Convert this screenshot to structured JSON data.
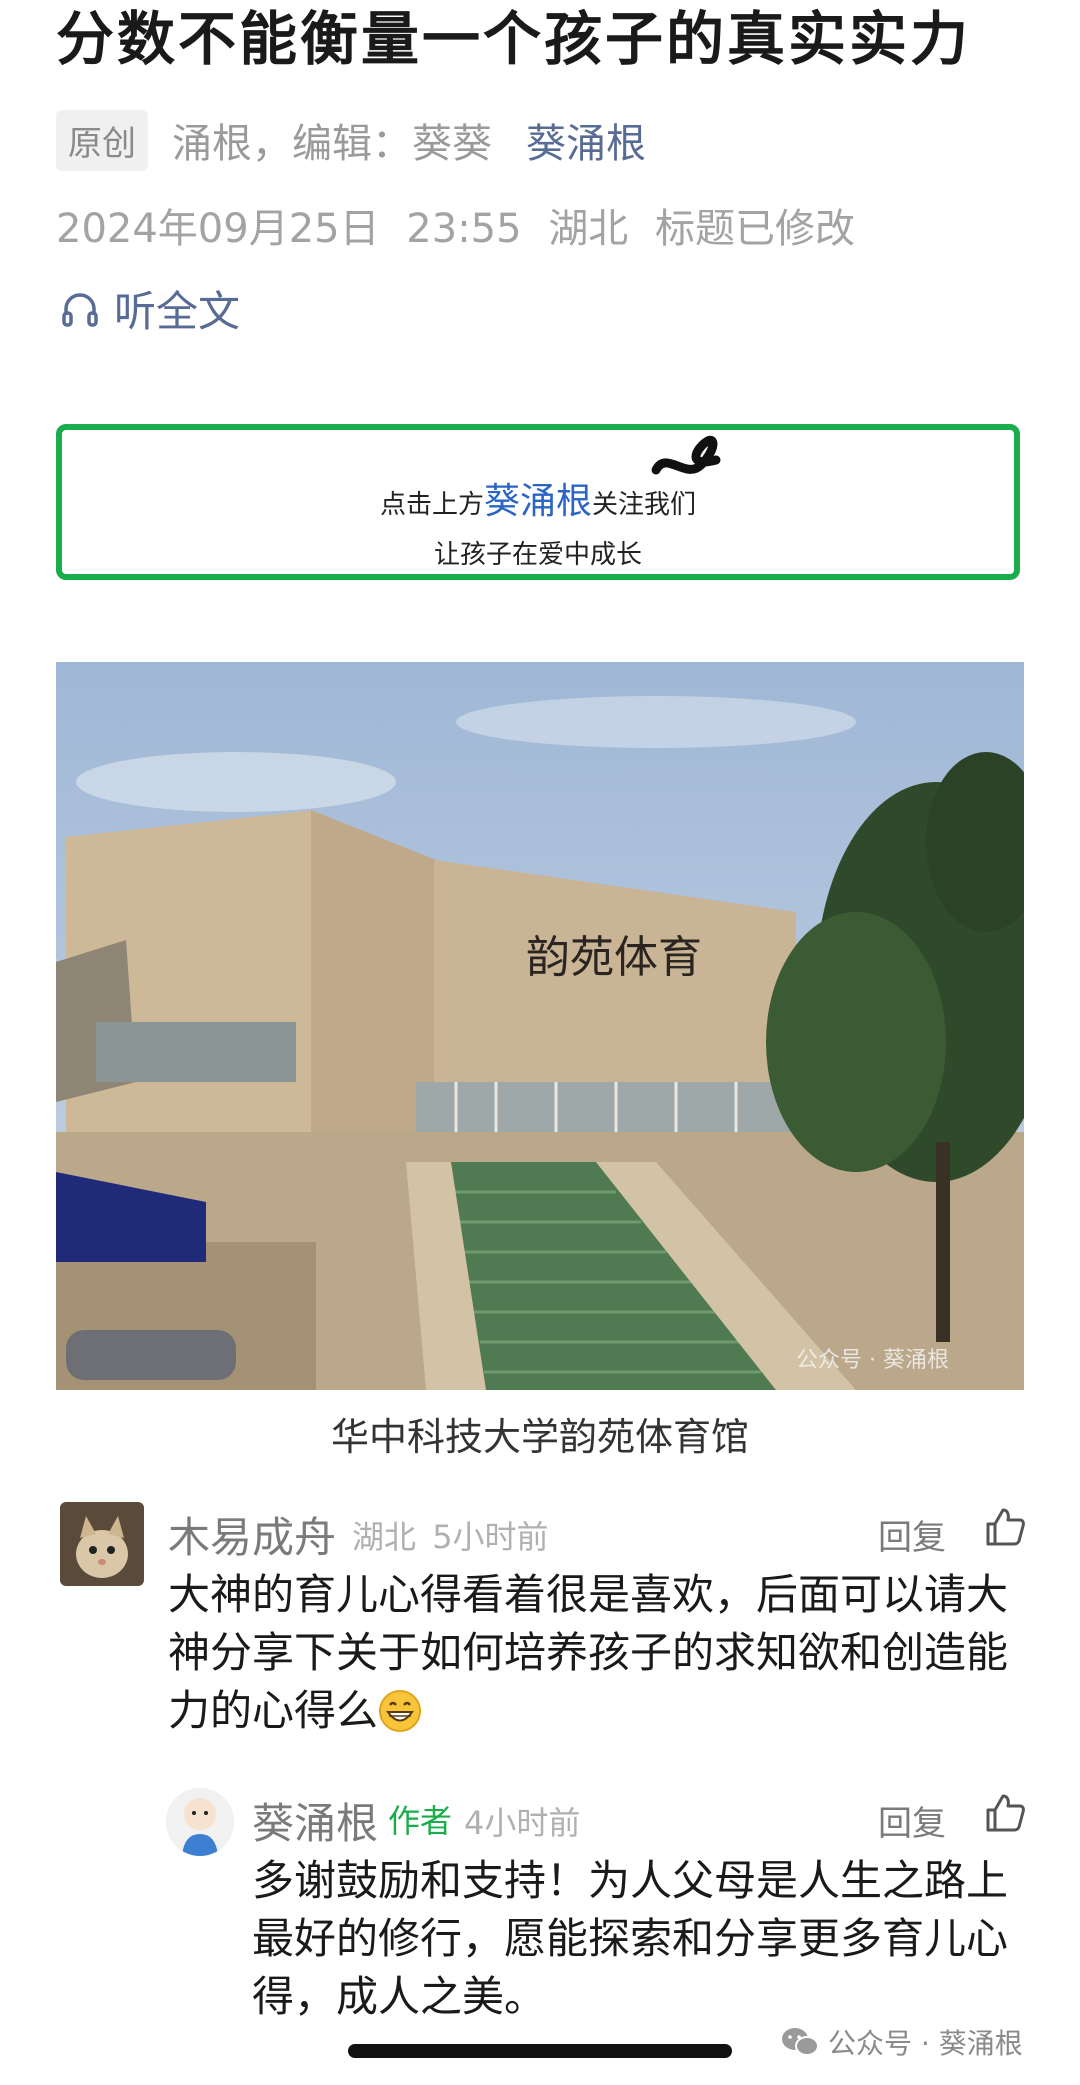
{
  "article": {
    "title": "分数不能衡量一个孩子的真实实力",
    "badge": "原创",
    "authors": "涌根，编辑：葵葵",
    "account": "葵涌根",
    "datetime": "2024年09月25日 23:55",
    "location": "湖北",
    "edited": "标题已修改",
    "listen": "听全文"
  },
  "follow_banner": {
    "prefix": "点击上方",
    "account": "葵涌根",
    "suffix": "关注我们",
    "line2": "让孩子在爱中成长",
    "border_color": "#1aad4b"
  },
  "photo": {
    "sign": "韵苑体育",
    "watermark": "公众号 · 葵涌根",
    "caption": "华中科技大学韵苑体育馆"
  },
  "comments": [
    {
      "name": "木易成舟",
      "location": "湖北",
      "time": "5小时前",
      "reply_label": "回复",
      "text": "大神的育儿心得看着很是喜欢，后面可以请大神分享下关于如何培养孩子的求知欲和创造能力的心得么",
      "emoji": "grin-emoji"
    },
    {
      "name": "葵涌根",
      "tag": "作者",
      "time": "4小时前",
      "reply_label": "回复",
      "text": "多谢鼓励和支持！为人父母是人生之路上最好的修行，愿能探索和分享更多育儿心得，成人之美。"
    }
  ],
  "watermark": "公众号 · 葵涌根",
  "colors": {
    "link": "#576b95",
    "author_tag": "#1aad4b",
    "meta_gray": "#9a9a9a"
  }
}
